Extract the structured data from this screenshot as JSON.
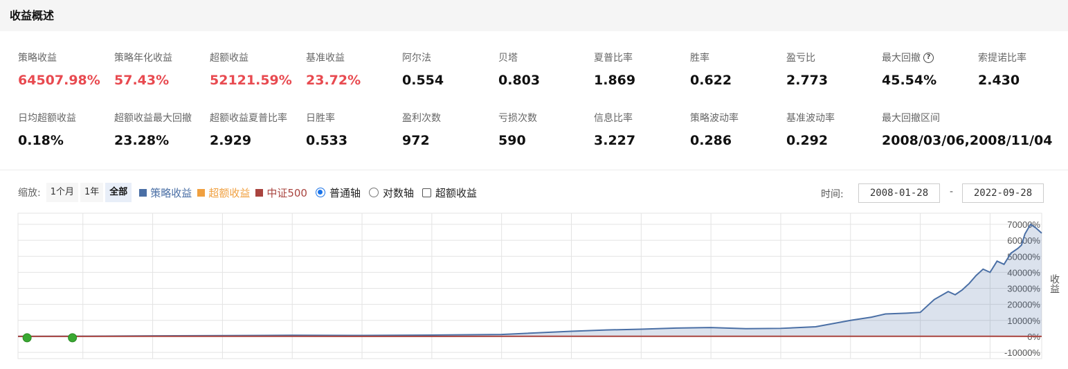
{
  "header": {
    "title": "收益概述"
  },
  "metrics_row1": [
    {
      "label": "策略收益",
      "value": "64507.98%",
      "red": true
    },
    {
      "label": "策略年化收益",
      "value": "57.43%",
      "red": true
    },
    {
      "label": "超额收益",
      "value": "52121.59%",
      "red": true
    },
    {
      "label": "基准收益",
      "value": "23.72%",
      "red": true
    },
    {
      "label": "阿尔法",
      "value": "0.554",
      "red": false
    },
    {
      "label": "贝塔",
      "value": "0.803",
      "red": false
    },
    {
      "label": "夏普比率",
      "value": "1.869",
      "red": false
    },
    {
      "label": "胜率",
      "value": "0.622",
      "red": false
    },
    {
      "label": "盈亏比",
      "value": "2.773",
      "red": false
    },
    {
      "label": "最大回撤",
      "value": "45.54%",
      "red": false,
      "help": "?"
    },
    {
      "label": "索提诺比率",
      "value": "2.430",
      "red": false
    }
  ],
  "metrics_row2": [
    {
      "label": "日均超额收益",
      "value": "0.18%"
    },
    {
      "label": "超额收益最大回撤",
      "value": "23.28%"
    },
    {
      "label": "超额收益夏普比率",
      "value": "2.929"
    },
    {
      "label": "日胜率",
      "value": "0.533"
    },
    {
      "label": "盈利次数",
      "value": "972"
    },
    {
      "label": "亏损次数",
      "value": "590"
    },
    {
      "label": "信息比率",
      "value": "3.227"
    },
    {
      "label": "策略波动率",
      "value": "0.286"
    },
    {
      "label": "基准波动率",
      "value": "0.292"
    },
    {
      "label": "最大回撤区间",
      "value": "2008/03/06,2008/11/04"
    }
  ],
  "toolbar": {
    "zoom_label": "缩放:",
    "zoom_options": [
      "1个月",
      "1年",
      "全部"
    ],
    "zoom_active": "全部",
    "legend": [
      {
        "label": "策略收益",
        "color": "#4a6fa5"
      },
      {
        "label": "超额收益",
        "color": "#f0a040"
      },
      {
        "label": "中证500",
        "color": "#a9443f"
      }
    ],
    "axis_normal": "普通轴",
    "axis_log": "对数轴",
    "excess_checkbox": "超额收益"
  },
  "time": {
    "label": "时间:",
    "start": "2008-01-28",
    "sep": "-",
    "end": "2022-09-28"
  },
  "chart_data": {
    "type": "area",
    "ylabel": "收益",
    "ylim": [
      -10000,
      70000
    ],
    "yticks": [
      "70000%",
      "60000%",
      "50000%",
      "40000%",
      "30000%",
      "20000%",
      "10000%",
      "0%",
      "-10000%"
    ],
    "x_start": "2008-01-28",
    "x_end": "2022-09-28",
    "grid": true,
    "series": [
      {
        "name": "策略收益",
        "color": "#4a6fa5",
        "x": [
          2008.07,
          2009.0,
          2010.0,
          2011.0,
          2012.0,
          2013.0,
          2014.0,
          2015.0,
          2015.3,
          2016.0,
          2016.5,
          2017.0,
          2017.5,
          2018.0,
          2018.5,
          2019.0,
          2019.5,
          2020.0,
          2020.3,
          2020.5,
          2020.8,
          2021.0,
          2021.2,
          2021.4,
          2021.5,
          2021.6,
          2021.7,
          2021.8,
          2021.9,
          2022.0,
          2022.1,
          2022.2,
          2022.3,
          2022.4,
          2022.45,
          2022.5,
          2022.58,
          2022.65,
          2022.74
        ],
        "values": [
          0,
          100,
          300,
          500,
          700,
          600,
          800,
          1200,
          1800,
          3200,
          4000,
          4500,
          5200,
          5500,
          4800,
          5000,
          6000,
          10000,
          12000,
          14000,
          14500,
          15000,
          23000,
          28000,
          26000,
          29000,
          33000,
          38000,
          42000,
          40000,
          47000,
          45000,
          52000,
          55000,
          57000,
          64000,
          70000,
          68000,
          64508
        ]
      },
      {
        "name": "中证500",
        "color": "#a9443f",
        "x": [
          2008.07,
          2010.0,
          2012.0,
          2014.0,
          2016.0,
          2018.0,
          2020.0,
          2022.0,
          2022.74
        ],
        "values": [
          0,
          40,
          30,
          20,
          60,
          30,
          40,
          50,
          24
        ]
      }
    ],
    "markers": [
      {
        "x": 2008.2,
        "value": 0,
        "color": "#3aa832"
      },
      {
        "x": 2008.85,
        "value": 0,
        "color": "#3aa832"
      }
    ]
  }
}
